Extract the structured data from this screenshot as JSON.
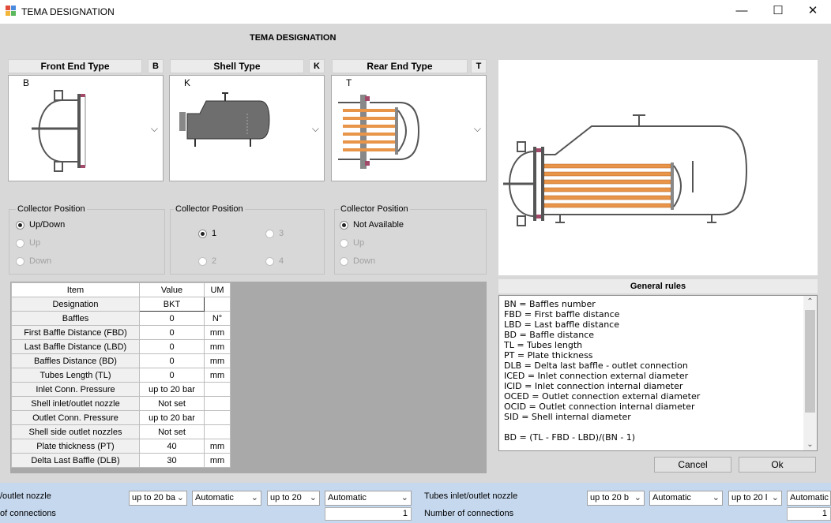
{
  "window": {
    "title": "TEMA DESIGNATION",
    "minimize": "—",
    "maximize": "☐",
    "close": "✕"
  },
  "heading": "TEMA DESIGNATION",
  "front": {
    "header": "Front End Type",
    "code": "B",
    "picker_code": "B"
  },
  "shell": {
    "header": "Shell Type",
    "code": "K",
    "picker_code": "K"
  },
  "rear": {
    "header": "Rear End Type",
    "code": "T",
    "picker_code": "T"
  },
  "chevron": "⌵",
  "collector1": {
    "label": "Collector Position",
    "options": [
      "Up/Down",
      "Up",
      "Down"
    ],
    "selected": "Up/Down"
  },
  "collector2": {
    "label": "Collector Position",
    "options": [
      "1",
      "3",
      "2",
      "4"
    ],
    "selected": "1"
  },
  "collector3": {
    "label": "Collector Position",
    "options": [
      "Not Available",
      "Up",
      "Down"
    ],
    "selected": "Not Available"
  },
  "grid": {
    "headers": [
      "Item",
      "Value",
      "UM"
    ],
    "rows": [
      {
        "item": "Designation",
        "value": "BKT",
        "um": ""
      },
      {
        "item": "Baffles",
        "value": "0",
        "um": "N°"
      },
      {
        "item": "First Baffle Distance (FBD)",
        "value": "0",
        "um": "mm"
      },
      {
        "item": "Last Baffle Distance (LBD)",
        "value": "0",
        "um": "mm"
      },
      {
        "item": "Baffles Distance (BD)",
        "value": "0",
        "um": "mm"
      },
      {
        "item": "Tubes Length (TL)",
        "value": "0",
        "um": "mm"
      },
      {
        "item": "Inlet Conn. Pressure",
        "value": "up to 20 bar",
        "um": ""
      },
      {
        "item": "Shell inlet/outlet nozzle",
        "value": "Not set",
        "um": ""
      },
      {
        "item": "Outlet Conn. Pressure",
        "value": "up to 20 bar",
        "um": ""
      },
      {
        "item": "Shell side outlet nozzles",
        "value": "Not set",
        "um": ""
      },
      {
        "item": "Plate thickness (PT)",
        "value": "40",
        "um": "mm"
      },
      {
        "item": "Delta Last Baffle (DLB)",
        "value": "30",
        "um": "mm"
      }
    ]
  },
  "rules": {
    "header": "General rules",
    "text": "BN = Baffles number\nFBD = First baffle distance\nLBD = Last baffle distance\nBD = Baffle distance\nTL = Tubes length\nPT = Plate thickness\nDLB = Delta last baffle - outlet connection\nICED = Inlet connection external diameter\nICID = Inlet connection internal diameter\nOCED = Outlet connection external diameter\nOCID = Outlet connection internal diameter\nSID = Shell internal diameter\n\nBD = (TL - FBD - LBD)/(BN - 1)",
    "scroll_up": "⌃",
    "scroll_down": "⌄"
  },
  "buttons": {
    "cancel": "Cancel",
    "ok": "Ok"
  },
  "bottom": {
    "left_label1": "/outlet nozzle",
    "left_label2": "of connections",
    "right_label1": "Tubes inlet/outlet nozzle",
    "right_label2": "Number of connections",
    "combos_left": [
      "up to 20 ba",
      "Automatic",
      "up to 20",
      "Automatic"
    ],
    "combos_right": [
      "up to 20 b",
      "Automatic",
      "up to 20 l",
      "Automatic"
    ],
    "count_left": "1",
    "count_right": "1",
    "arrow": "⌄"
  },
  "colors": {
    "tube": "#e8954a",
    "tube_dark": "#b5601c",
    "shell": "#6e6e6e",
    "flange": "#a34a6a",
    "strip": "#c6d8ee"
  }
}
